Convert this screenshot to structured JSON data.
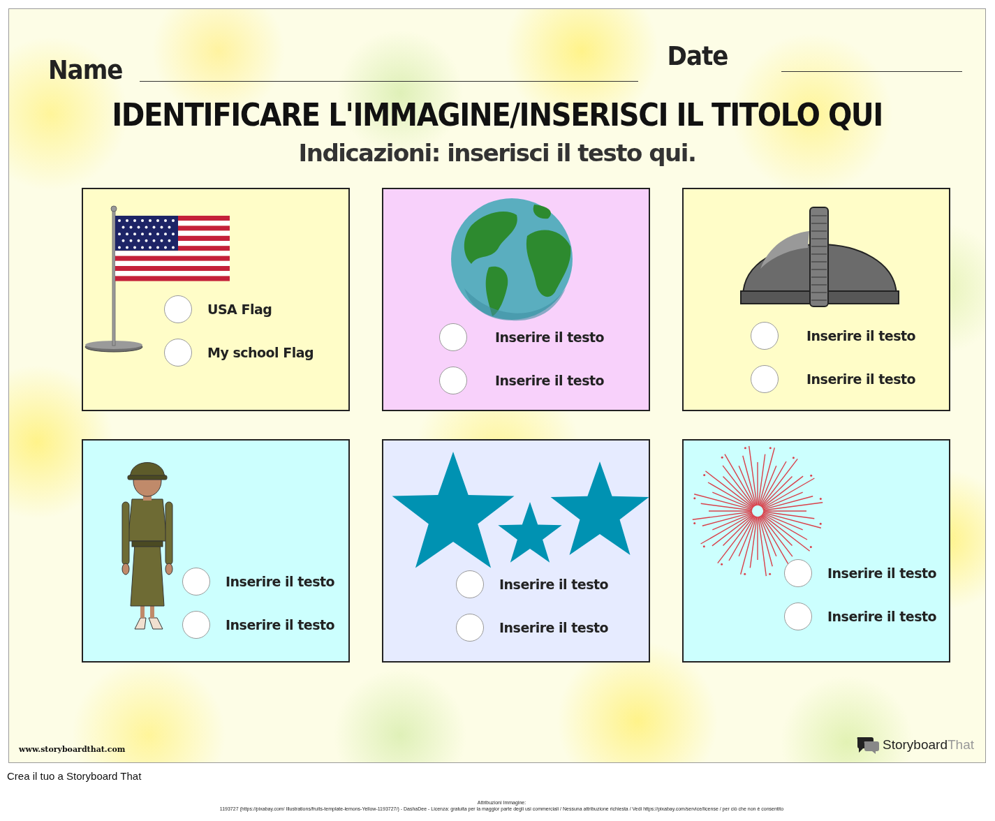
{
  "worksheet": {
    "name_label": "Name",
    "date_label": "Date",
    "title": "IDENTIFICARE L'IMMAGINE/INSERISCI IL TITOLO QUI",
    "directions": "Indicazioni: inserisci il testo qui.",
    "cards": [
      {
        "kind": "flag",
        "color": "#fffdc8",
        "options": [
          "USA Flag",
          "My school Flag"
        ]
      },
      {
        "kind": "globe",
        "color": "#f8d1fb",
        "options": [
          "Inserire il testo",
          "Inserire il testo"
        ]
      },
      {
        "kind": "helmet",
        "color": "#fffdc8",
        "options": [
          "Inserire il testo",
          "Inserire il testo"
        ]
      },
      {
        "kind": "soldier",
        "color": "#ccfffe",
        "options": [
          "Inserire il testo",
          "Inserire il testo"
        ]
      },
      {
        "kind": "stars",
        "color": "#e6ebff",
        "options": [
          "Inserire il testo",
          "Inserire il testo"
        ]
      },
      {
        "kind": "firework",
        "color": "#ccfffe",
        "options": [
          "Inserire il testo",
          "Inserire il testo"
        ]
      }
    ],
    "site": "www.storyboardthat.com",
    "logo_text": "Storyboard",
    "logo_suffix": "That"
  },
  "footer": {
    "link": "Crea il tuo a Storyboard That",
    "attribution_heading": "Attribuzioni Immagine:",
    "attribution": "1193727 (https://pixabay.com/ Illustrations/fruits-template-lemons-Yellow-1193727/) - DashaDee - Licenza: gratuita per la maggior parte degli usi commerciali / Nessuna attribuzione richiesta / Vedi https://pixabay.com/service/license / per ciò che non è consentito"
  }
}
